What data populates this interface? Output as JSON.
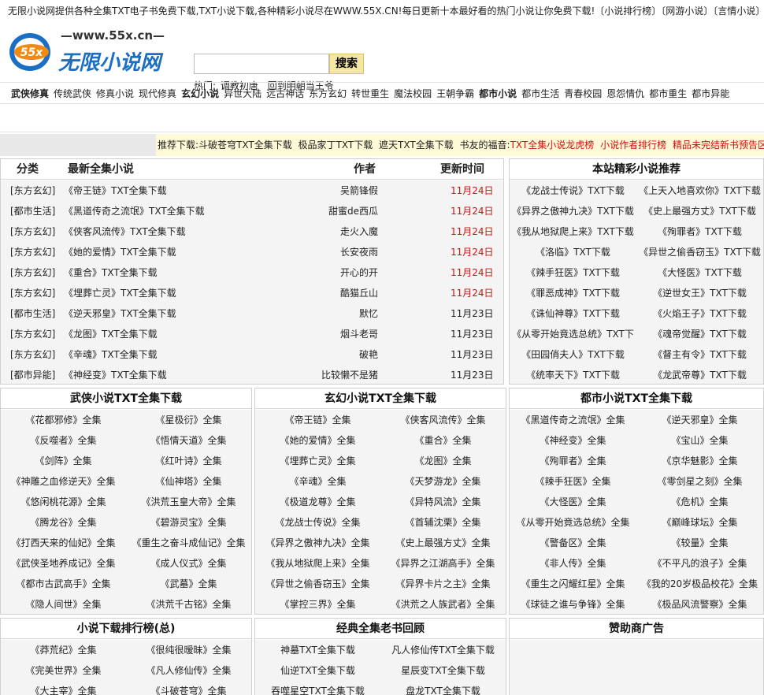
{
  "topbar": "无限小说网提供各种全集TXT电子书免费下载,TXT小说下载,各种精彩小说尽在WWW.55X.CN!每日更新十本最好看的热门小说让你免费下载!〔小说排行榜〕〔网游小说〕〔言情小说〕",
  "logo": {
    "url": "—www.55x.cn—",
    "badge": "55x",
    "name": "无限小说网"
  },
  "search": {
    "placeholder": "",
    "button": "搜索"
  },
  "hot": {
    "label": "热门:",
    "items": [
      "调教初唐",
      "回到明朝当王爷"
    ]
  },
  "nav": [
    {
      "label": "武侠修真",
      "bold": true
    },
    {
      "label": "传统武侠"
    },
    {
      "label": "修真小说"
    },
    {
      "label": "现代修真"
    },
    {
      "label": "玄幻小说",
      "bold": true
    },
    {
      "label": "异世大陆"
    },
    {
      "label": "远古神话"
    },
    {
      "label": "东方玄幻"
    },
    {
      "label": "转世重生"
    },
    {
      "label": "魔法校园"
    },
    {
      "label": "王朝争霸"
    },
    {
      "label": "都市小说",
      "bold": true
    },
    {
      "label": "都市生活"
    },
    {
      "label": "青春校园"
    },
    {
      "label": "恩怨情仇"
    },
    {
      "label": "都市重生"
    },
    {
      "label": "都市异能"
    }
  ],
  "recommend": {
    "label": "推荐下载:",
    "links": [
      "斗破苍穹TXT全集下载",
      "极品家丁TXT下载",
      "遮天TXT全集下载"
    ],
    "gospel": "书友的福音:",
    "red_links": [
      "TXT全集小说龙虎榜",
      "小说作者排行榜",
      "精品未完结新书预告区"
    ]
  },
  "latest": {
    "headers": {
      "category": "分类",
      "title": "最新全集小说",
      "author": "作者",
      "time": "更新时间"
    },
    "rows": [
      {
        "category": "[东方玄幻]",
        "title": "《帝王链》TXT全集下载",
        "author": "吴箭锋假",
        "time": "11月24日",
        "red": true
      },
      {
        "category": "[都市生活]",
        "title": "《黑道传奇之流氓》TXT全集下载",
        "author": "甜蜜de西瓜",
        "time": "11月24日",
        "red": true
      },
      {
        "category": "[东方玄幻]",
        "title": "《侠客风流传》TXT全集下载",
        "author": "走火入魔",
        "time": "11月24日",
        "red": true
      },
      {
        "category": "[东方玄幻]",
        "title": "《她的爱情》TXT全集下载",
        "author": "长安夜雨",
        "time": "11月24日",
        "red": true
      },
      {
        "category": "[东方玄幻]",
        "title": "《重合》TXT全集下载",
        "author": "开心的开",
        "time": "11月24日",
        "red": true
      },
      {
        "category": "[东方玄幻]",
        "title": "《埋葬亡灵》TXT全集下载",
        "author": "酷猫丘山",
        "time": "11月24日",
        "red": true
      },
      {
        "category": "[都市生活]",
        "title": "《逆天邪皇》TXT全集下载",
        "author": "默忆",
        "time": "11月23日",
        "red": false
      },
      {
        "category": "[东方玄幻]",
        "title": "《龙图》TXT全集下载",
        "author": "烟斗老哥",
        "time": "11月23日",
        "red": false
      },
      {
        "category": "[东方玄幻]",
        "title": "《辛魂》TXT全集下载",
        "author": "破艳",
        "time": "11月23日",
        "red": false
      },
      {
        "category": "[都市异能]",
        "title": "《神经变》TXT全集下载",
        "author": "比较懒不是猪",
        "time": "11月23日",
        "red": false
      }
    ]
  },
  "site_rec": {
    "title": "本站精彩小说推荐",
    "rows": [
      [
        "《龙战士传说》TXT下载",
        "《上天入地喜欢你》TXT下载"
      ],
      [
        "《异界之傲神九决》TXT下载",
        "《史上最强方丈》TXT下载"
      ],
      [
        "《我从地狱爬上来》TXT下载",
        "《殉罪者》TXT下载"
      ],
      [
        "《洛临》TXT下载",
        "《异世之偷香窃玉》TXT下载"
      ],
      [
        "《辣手狂医》TXT下载",
        "《大怪医》TXT下载"
      ],
      [
        "《罪恶成神》TXT下载",
        "《逆世女王》TXT下载"
      ],
      [
        "《诛仙神尊》TXT下载",
        "《火焰王子》TXT下载"
      ],
      [
        "《从零开始竟选总统》TXT下",
        "《魂帝觉醒》TXT下载"
      ],
      [
        "《田园俏夫人》TXT下载",
        "《督主有令》TXT下载"
      ],
      [
        "《统率天下》TXT下载",
        "《龙武帝尊》TXT下载"
      ]
    ]
  },
  "wuxia": {
    "title": "武侠小说TXT全集下载",
    "rows": [
      [
        "《花都邪修》全集",
        "《星极衍》全集"
      ],
      [
        "《反噬者》全集",
        "《悟情天道》全集"
      ],
      [
        "《剑阵》全集",
        "《红叶诗》全集"
      ],
      [
        "《神雕之血修逆天》全集",
        "《仙神塔》全集"
      ],
      [
        "《悠闲桃花源》全集",
        "《洪荒玉皇大帝》全集"
      ],
      [
        "《腾龙谷》全集",
        "《碧游灵宝》全集"
      ],
      [
        "《打西天来的仙妃》全集",
        "《重生之奋斗成仙记》全集"
      ],
      [
        "《武侠圣地养成记》全集",
        "《成人仪式》全集"
      ],
      [
        "《都市古武高手》全集",
        "《武墓》全集"
      ],
      [
        "《隐人间世》全集",
        "《洪荒千古铭》全集"
      ]
    ]
  },
  "xuanhuan": {
    "title": "玄幻小说TXT全集下载",
    "rows": [
      [
        "《帝王链》全集",
        "《侠客风流传》全集"
      ],
      [
        "《她的爱情》全集",
        "《重合》全集"
      ],
      [
        "《埋葬亡灵》全集",
        "《龙图》全集"
      ],
      [
        "《辛魂》全集",
        "《天梦游龙》全集"
      ],
      [
        "《极道龙尊》全集",
        "《异特风流》全集"
      ],
      [
        "《龙战士传说》全集",
        "《首辅沈栗》全集"
      ],
      [
        "《异界之傲神九决》全集",
        "《史上最强方丈》全集"
      ],
      [
        "《我从地狱爬上来》全集",
        "《异界之江湖高手》全集"
      ],
      [
        "《异世之偷香窃玉》全集",
        "《异界卡片之主》全集"
      ],
      [
        "《掌控三界》全集",
        "《洪荒之人族武者》全集"
      ]
    ]
  },
  "dushi": {
    "title": "都市小说TXT全集下载",
    "rows": [
      [
        "《黑道传奇之流氓》全集",
        "《逆天邪皇》全集"
      ],
      [
        "《神经变》全集",
        "《宝山》全集"
      ],
      [
        "《殉罪者》全集",
        "《京华魅影》全集"
      ],
      [
        "《辣手狂医》全集",
        "《零剑星之刻》全集"
      ],
      [
        "《大怪医》全集",
        "《危机》全集"
      ],
      [
        "《从零开始竟选总统》全集",
        "《巅峰球坛》全集"
      ],
      [
        "《警备区》全集",
        "《较量》全集"
      ],
      [
        "《非人传》全集",
        "《不平凡的浪子》全集"
      ],
      [
        "《重生之闪耀红星》全集",
        "《我的20岁极品校花》全集"
      ],
      [
        "《球徒之谁与争锋》全集",
        "《极品风流警察》全集"
      ]
    ]
  },
  "ranking": {
    "title": "小说下载排行榜(总)",
    "rows": [
      [
        "《莽荒纪》全集",
        "《很纯很暧昧》全集"
      ],
      [
        "《完美世界》全集",
        "《凡人修仙传》全集"
      ],
      [
        "《大主宰》全集",
        "《斗破苍穹》全集"
      ]
    ]
  },
  "classic": {
    "title": "经典全集老书回顾",
    "rows": [
      [
        "神墓TXT全集下载",
        "凡人修仙传TXT全集下载"
      ],
      [
        "仙逆TXT全集下载",
        "星辰变TXT全集下载"
      ],
      [
        "吞噬星空TXT全集下载",
        "盘龙TXT全集下载"
      ]
    ]
  },
  "ads": {
    "title": "赞助商广告"
  },
  "colors": {
    "red": "#d01010",
    "logo_blue": "#1a6fc4",
    "logo_orange": "#f08a10",
    "button_bg": "#f3e7a6",
    "rec_bg": "#fef9d6"
  }
}
